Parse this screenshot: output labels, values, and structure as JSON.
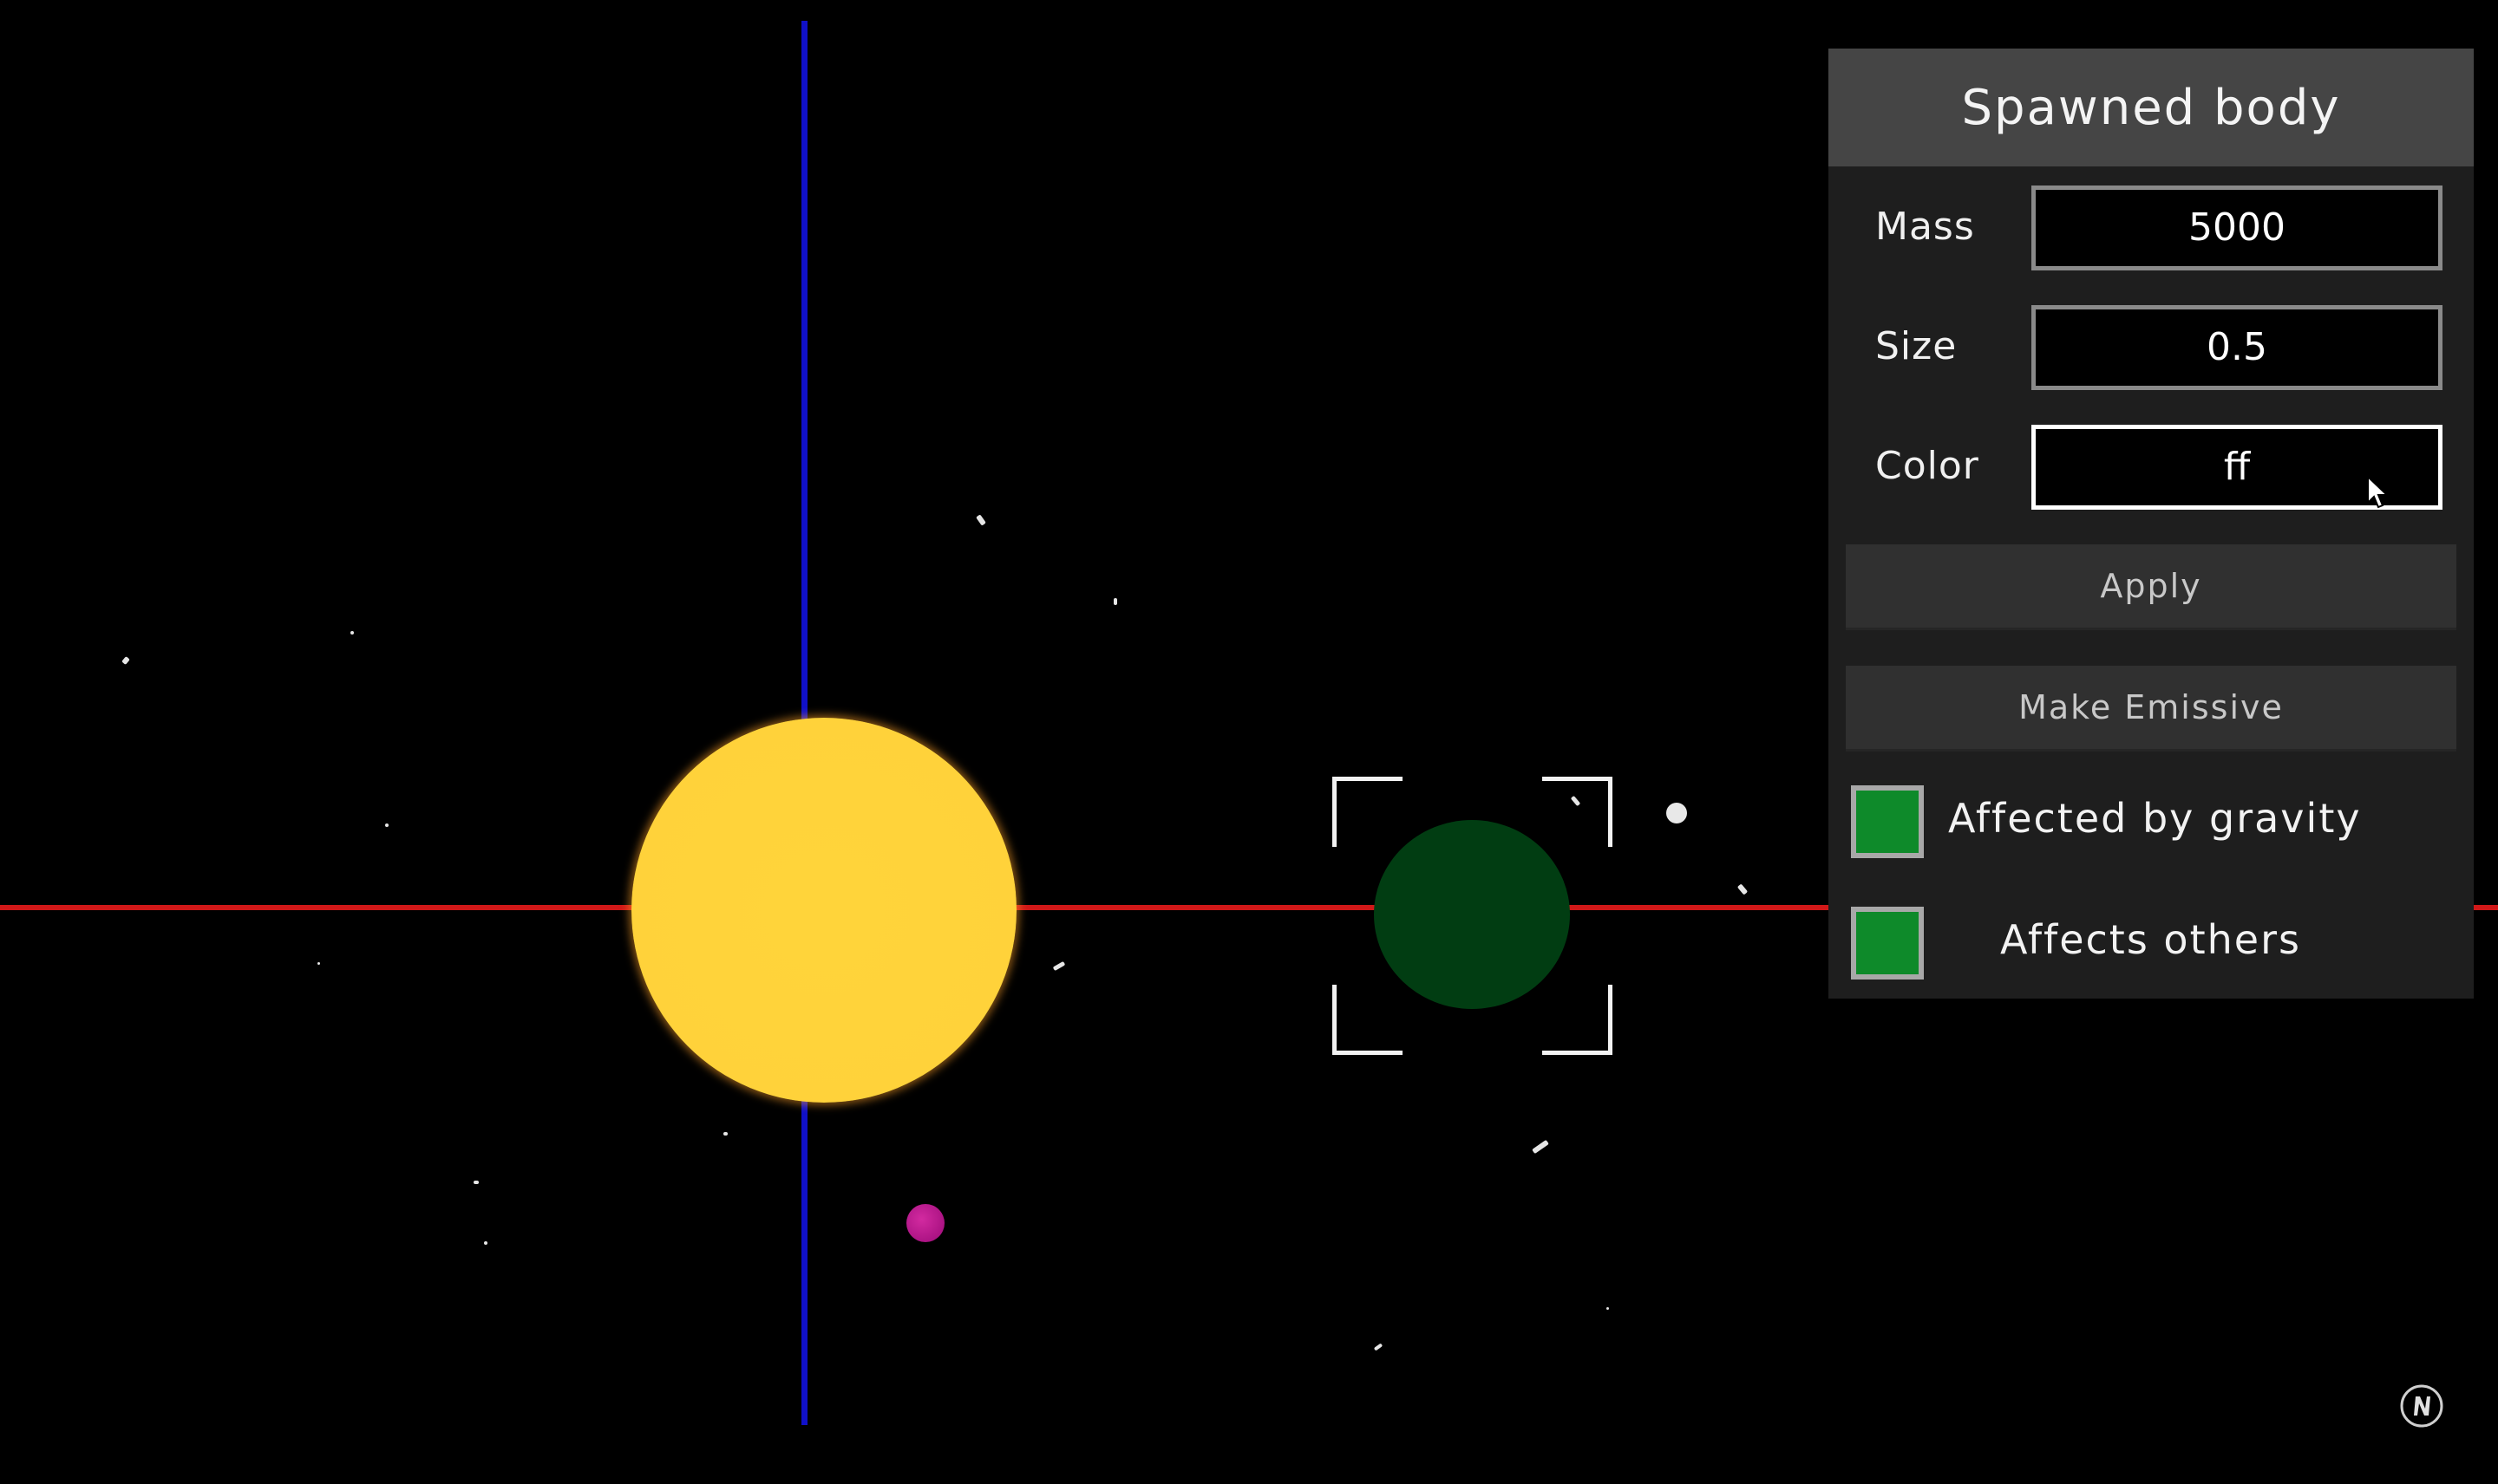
{
  "panel": {
    "title": "Spawned body",
    "fields": [
      {
        "label": "Mass",
        "value": "5000"
      },
      {
        "label": "Size",
        "value": "0.5"
      },
      {
        "label": "Color",
        "value": "ff"
      }
    ],
    "buttons": {
      "apply": "Apply",
      "make_emissive": "Make Emissive"
    },
    "toggles": [
      {
        "label": "Affected by gravity",
        "checked": true
      },
      {
        "label": "Affects others",
        "checked": true
      }
    ]
  },
  "scene": {
    "axes": {
      "x_color": "#d01818",
      "y_color": "#1010c8"
    },
    "bodies": [
      {
        "name": "sun",
        "color": "#ffd23a"
      },
      {
        "name": "selected-body",
        "color": "#013d12",
        "selected": true
      },
      {
        "name": "magenta-body",
        "color": "#b0128a"
      },
      {
        "name": "small-white-body",
        "color": "#e8e8e8"
      }
    ]
  },
  "icons": {
    "cursor": "mouse-pointer-icon",
    "watermark": "n-logo-icon"
  }
}
